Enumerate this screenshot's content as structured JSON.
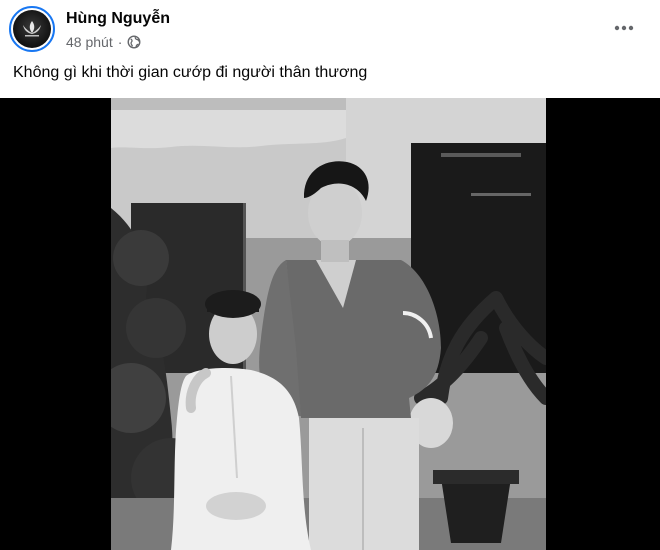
{
  "post": {
    "author_name": "Hùng Nguyễn",
    "time_ago": "48 phút",
    "privacy_icon": "globe-icon",
    "more_icon": "more-options-icon",
    "caption": "Không gì khi thời gian cướp đi người thân thương"
  },
  "colors": {
    "avatar_ring": "#1877f2",
    "meta_text": "#65676b",
    "primary_text": "#050505"
  }
}
